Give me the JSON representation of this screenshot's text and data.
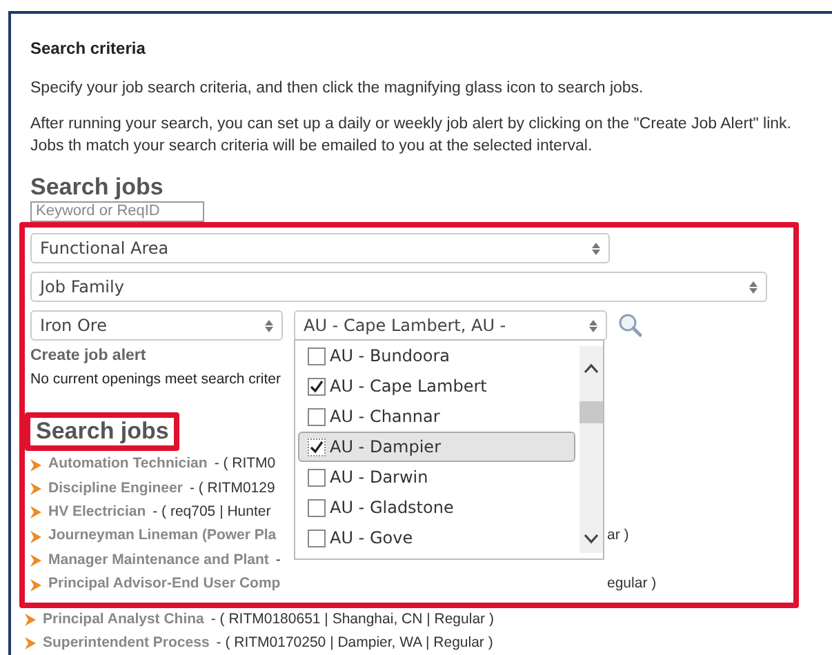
{
  "criteria": {
    "heading": "Search criteria",
    "paragraphs": [
      "Specify your job search criteria, and then click the magnifying glass icon to search jobs.",
      "After running your search, you can set up a daily or weekly job alert by clicking on the \"Create Job Alert\" link. Jobs th match your search criteria will be emailed to you at the selected interval."
    ]
  },
  "search": {
    "title": "Search jobs",
    "keyword": {
      "placeholder": "Keyword or ReqID"
    },
    "functional_area": {
      "value": "Functional Area"
    },
    "job_family": {
      "value": "Job Family"
    },
    "business": {
      "value": "Iron Ore"
    },
    "location": {
      "value": "AU - Cape Lambert, AU -",
      "expanded": true,
      "options": [
        {
          "label": "AU - Bundoora",
          "checked": false,
          "selected": false
        },
        {
          "label": "AU - Cape Lambert",
          "checked": true,
          "selected": false
        },
        {
          "label": "AU - Channar",
          "checked": false,
          "selected": false
        },
        {
          "label": "AU - Dampier",
          "checked": true,
          "selected": true
        },
        {
          "label": "AU - Darwin",
          "checked": false,
          "selected": false
        },
        {
          "label": "AU - Gladstone",
          "checked": false,
          "selected": false
        },
        {
          "label": "AU - Gove",
          "checked": false,
          "selected": false
        }
      ]
    },
    "create_alert": "Create job alert",
    "message": "No current openings meet search criter"
  },
  "results": {
    "title": "Search jobs",
    "jobs": [
      {
        "title": "Automation Technician",
        "detail": "- ( RITM0"
      },
      {
        "title": "Discipline Engineer",
        "detail": "- ( RITM0129"
      },
      {
        "title": "HV Electrician",
        "detail": "- ( req705 | Hunter"
      },
      {
        "title": "Journeyman Lineman (Power Pla",
        "tail": "ar )"
      },
      {
        "title": "Manager Maintenance and Plant",
        "detail": "-"
      },
      {
        "title": "Principal Advisor-End User Comp",
        "tail": "egular )"
      },
      {
        "title": "Principal Analyst China",
        "detail": "- ( RITM0180651 | Shanghai, CN | Regular )"
      },
      {
        "title": "Superintendent Process",
        "detail": "- ( RITM0170250 | Dampier, WA | Regular )"
      }
    ]
  }
}
